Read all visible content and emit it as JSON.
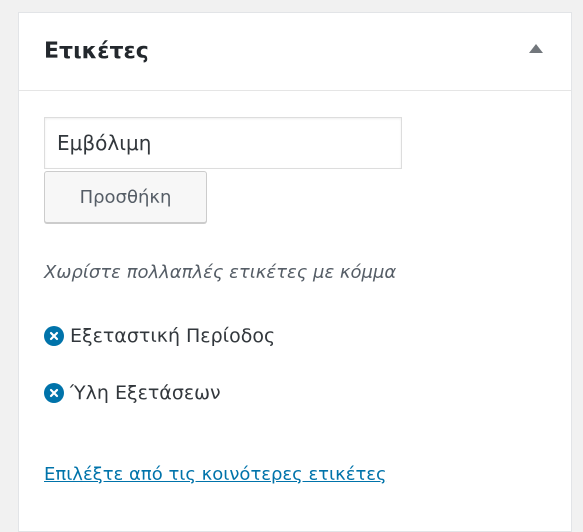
{
  "panel": {
    "title": "Ετικέτες"
  },
  "tag_input": {
    "value": "Εμβόλιμη"
  },
  "add_button": {
    "label": "Προσθήκη"
  },
  "hint": "Χωρίστε πολλαπλές ετικέτες με κόμμα",
  "tags": [
    {
      "label": "Εξεταστική Περίοδος"
    },
    {
      "label": "Ύλη Εξετάσεων"
    }
  ],
  "popular_link": "Επιλέξτε από τις κοινότερες ετικέτες",
  "colors": {
    "accent": "#0073aa",
    "background": "#f1f1f1",
    "panel": "#ffffff"
  },
  "icons": {
    "toggle": "triangle-up-icon",
    "remove": "remove-circle-icon"
  }
}
